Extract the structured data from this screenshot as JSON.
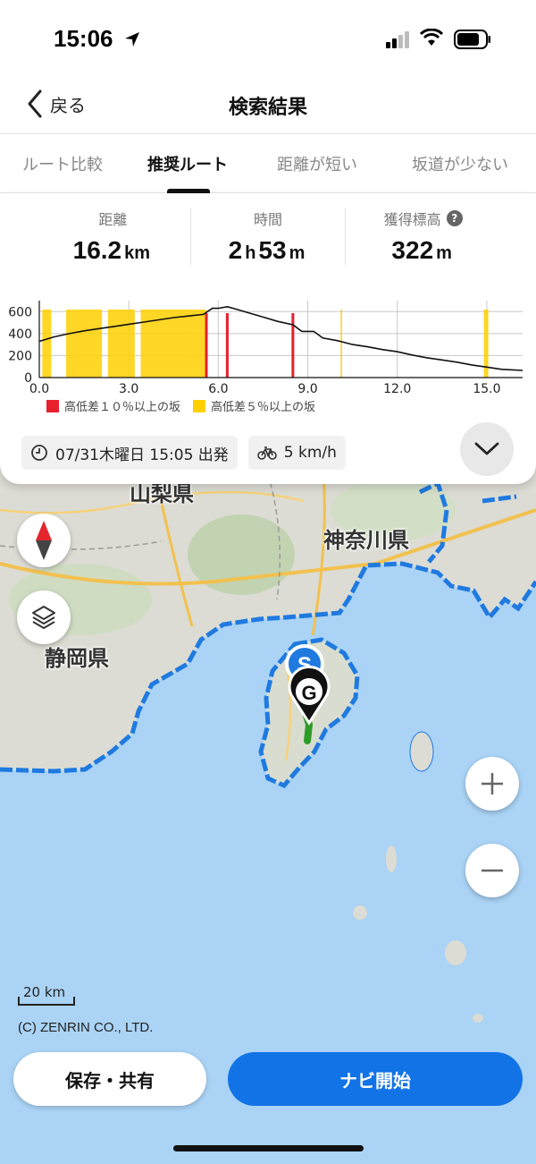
{
  "status": {
    "time": "15:06"
  },
  "nav": {
    "back_label": "戻る",
    "title": "検索結果"
  },
  "tabs": [
    {
      "label": "ルート比較"
    },
    {
      "label": "推奨ルート",
      "selected": true
    },
    {
      "label": "距離が短い"
    },
    {
      "label": "坂道が少ない"
    }
  ],
  "stats": {
    "distance": {
      "label": "距離",
      "value": "16.2",
      "unit": "km"
    },
    "time": {
      "label": "時間",
      "hours": "2",
      "hours_unit": "h",
      "minutes": "53",
      "minutes_unit": "m"
    },
    "elevation_gain": {
      "label": "獲得標高",
      "value": "322",
      "unit": "m",
      "help_icon": "question-icon"
    }
  },
  "chart_data": {
    "type": "area",
    "xlabel": "",
    "ylabel": "",
    "x_ticks": [
      "0.0",
      "3.0",
      "6.0",
      "9.0",
      "12.0",
      "15.0"
    ],
    "y_ticks": [
      "0",
      "200",
      "400",
      "600"
    ],
    "xlim": [
      0,
      16.2
    ],
    "ylim": [
      0,
      700
    ],
    "series": [
      {
        "x": [
          0,
          0.5,
          1,
          1.5,
          2,
          2.5,
          3,
          3.5,
          4,
          4.5,
          5,
          5.5,
          5.8,
          6.0,
          6.3,
          6.5,
          7,
          7.5,
          8,
          8.5,
          8.8,
          9.2,
          9.5,
          10,
          10.5,
          11,
          11.5,
          12,
          12.5,
          13,
          13.5,
          14,
          14.5,
          15,
          15.5,
          16.2
        ],
        "y": [
          330,
          370,
          400,
          425,
          445,
          465,
          485,
          505,
          525,
          545,
          560,
          575,
          630,
          630,
          645,
          630,
          590,
          550,
          510,
          480,
          420,
          420,
          360,
          335,
          300,
          280,
          255,
          235,
          205,
          180,
          160,
          140,
          115,
          95,
          75,
          65
        ]
      }
    ],
    "steep_10pct_x": [
      5.6,
      6.3,
      8.5
    ],
    "steep_5pct_ranges": [
      [
        0.1,
        0.4
      ],
      [
        0.9,
        2.1
      ],
      [
        2.3,
        3.2
      ],
      [
        3.4,
        5.6
      ],
      [
        10.1,
        10.15
      ],
      [
        14.9,
        15.05
      ]
    ],
    "legend": [
      {
        "label": "高低差１０％以上の坂",
        "color": "#e8202e"
      },
      {
        "label": "高低差５％以上の坂",
        "color": "#ffd000"
      }
    ]
  },
  "trip": {
    "departure": "07/31木曜日 15:05 出発",
    "speed": "5 km/h"
  },
  "map": {
    "labels": {
      "yamanashi": "山梨県",
      "kanagawa": "神奈川県",
      "shizuoka": "静岡県"
    },
    "start_marker": "S",
    "goal_marker": "G",
    "scale": "20 km",
    "copyright": "(C) ZENRIN CO., LTD.",
    "route_color": "#1f7ae0",
    "sea_color": "#aad3f5"
  },
  "actions": {
    "save_share": "保存・共有",
    "start_nav": "ナビ開始"
  }
}
